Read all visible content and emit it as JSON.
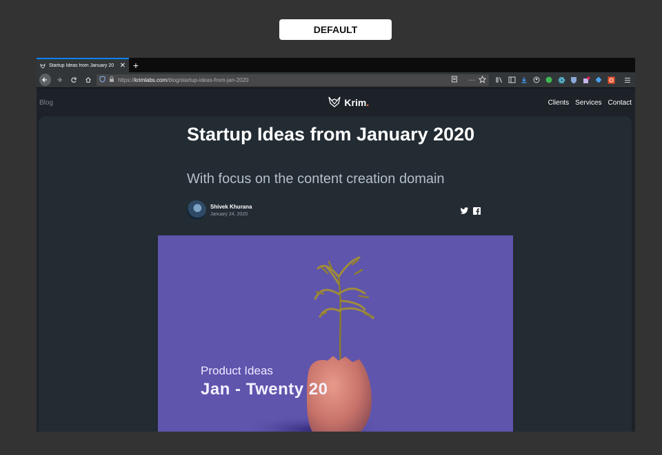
{
  "label": "DEFAULT",
  "browser": {
    "tab_title": "Startup Ideas from January 20",
    "url_prefix": "https://",
    "url_host": "krimlabs.com",
    "url_path": "/blog/startup-ideas-from-jan-2020"
  },
  "site": {
    "nav_blog": "Blog",
    "logo": "Krim",
    "logo_dot": ".",
    "links": [
      "Clients",
      "Services",
      "Contact"
    ]
  },
  "article": {
    "title": "Startup Ideas from January 2020",
    "subtitle": "With focus on the content creation domain",
    "author": "Shivek Khurana",
    "date": "January 24, 2020"
  },
  "hero": {
    "line1": "Product Ideas",
    "line2": "Jan - Twenty  20",
    "background": "#5f55ad"
  }
}
